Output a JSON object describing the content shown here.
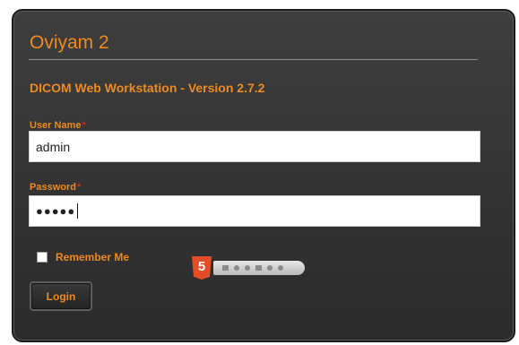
{
  "app": {
    "title": "Oviyam 2",
    "subtitle": "DICOM Web Workstation - Version 2.7.2"
  },
  "form": {
    "username": {
      "label": "User Name",
      "required_mark": "*",
      "value": "admin"
    },
    "password": {
      "label": "Password",
      "required_mark": "*",
      "value": "●●●●●"
    },
    "remember": {
      "label": "Remember Me",
      "checked": false
    },
    "login_label": "Login"
  },
  "badges": {
    "html5_glyph": "5",
    "html5_icon": "html5-logo-icon"
  },
  "colors": {
    "accent": "#ee8a1e",
    "required": "#cc2a1a",
    "panel_bg": "#353535"
  }
}
